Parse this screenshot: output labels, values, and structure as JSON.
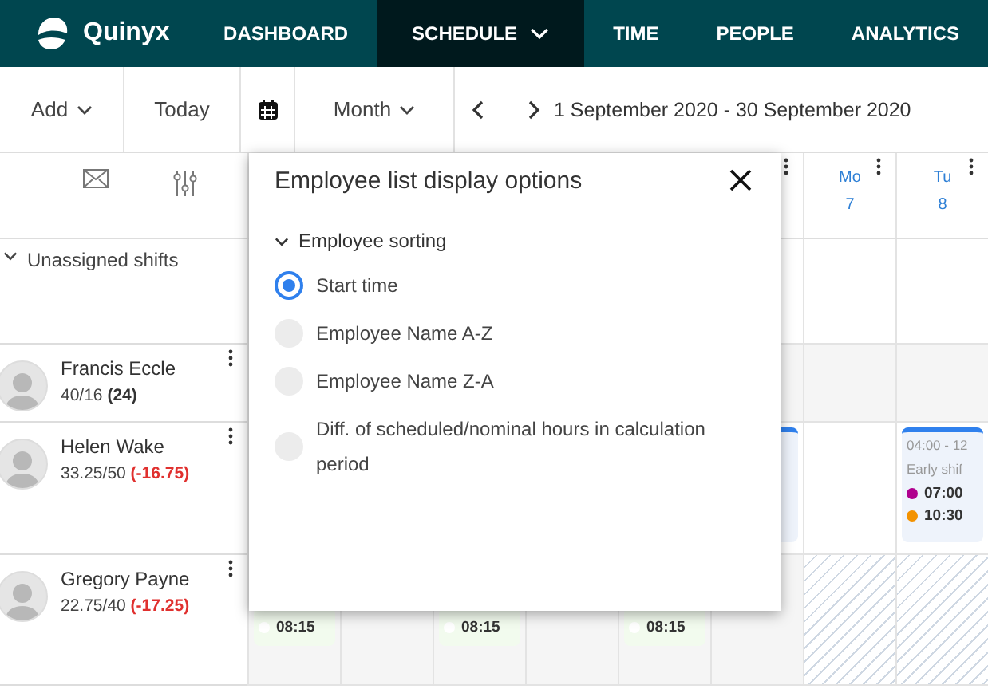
{
  "nav": {
    "brand": "Quinyx",
    "items": [
      {
        "label": "DASHBOARD",
        "selected": false,
        "dropdown": false
      },
      {
        "label": "SCHEDULE",
        "selected": true,
        "dropdown": true
      },
      {
        "label": "TIME",
        "selected": false,
        "dropdown": false
      },
      {
        "label": "PEOPLE",
        "selected": false,
        "dropdown": false
      },
      {
        "label": "ANALYTICS",
        "selected": false,
        "dropdown": false
      }
    ]
  },
  "toolbar": {
    "add": "Add",
    "today": "Today",
    "view": "Month",
    "range": "1 September 2020 - 30 September 2020"
  },
  "day_headers": [
    {
      "menu": true
    },
    {
      "weekday": "Mo",
      "date": "7",
      "menu": true
    },
    {
      "weekday": "Tu",
      "date": "8",
      "menu": true
    }
  ],
  "unassigned": {
    "label": "Unassigned shifts",
    "cells": [
      {
        "kind": "blank"
      },
      {
        "kind": "blank"
      },
      {
        "kind": "blank"
      },
      {
        "kind": "blank"
      },
      {
        "kind": "blank"
      },
      {
        "kind": "blank"
      },
      {
        "kind": "blank"
      },
      {
        "kind": "blank"
      }
    ]
  },
  "employees": [
    {
      "name": "Francis Eccle",
      "hours": "40/16",
      "balance": "(24)",
      "negative": false,
      "cells": [
        {
          "kind": "shaded"
        },
        {
          "kind": "shaded"
        },
        {
          "kind": "shaded"
        },
        {
          "kind": "shaded"
        },
        {
          "kind": "shaded"
        },
        {
          "kind": "shaded"
        },
        {
          "kind": "shaded"
        },
        {
          "kind": "shaded"
        }
      ]
    },
    {
      "name": "Helen Wake",
      "hours": "33.25/50",
      "balance": "(-16.75)",
      "negative": true,
      "cells": [
        {
          "kind": "blank"
        },
        {
          "kind": "blank"
        },
        {
          "kind": "blank"
        },
        {
          "kind": "blank"
        },
        {
          "kind": "blank"
        },
        {
          "kind": "planned_shift"
        },
        {
          "kind": "blank"
        },
        {
          "kind": "planned_shift",
          "time_range": "04:00 - 12",
          "title": "Early shif",
          "tasks": [
            {
              "time": "07:00",
              "color": "#b0008e"
            },
            {
              "time": "10:30",
              "color": "#f39200"
            }
          ]
        }
      ]
    },
    {
      "name": "Gregory Payne",
      "hours": "22.75/40",
      "balance": "(-17.25)",
      "negative": true,
      "cells": [
        {
          "kind": "shift",
          "time": "08:15"
        },
        {
          "kind": "shaded"
        },
        {
          "kind": "shift",
          "time": "08:15"
        },
        {
          "kind": "shaded"
        },
        {
          "kind": "shift",
          "time": "08:15"
        },
        {
          "kind": "shaded"
        },
        {
          "kind": "hatched"
        },
        {
          "kind": "hatched"
        }
      ]
    }
  ],
  "dialog": {
    "title": "Employee list display options",
    "section": "Employee sorting",
    "options": [
      {
        "label": "Start time",
        "selected": true
      },
      {
        "label": "Employee Name A-Z",
        "selected": false
      },
      {
        "label": "Employee Name Z-A",
        "selected": false
      },
      {
        "label": "Diff. of scheduled/nominal hours in calculation period",
        "selected": false
      }
    ]
  }
}
